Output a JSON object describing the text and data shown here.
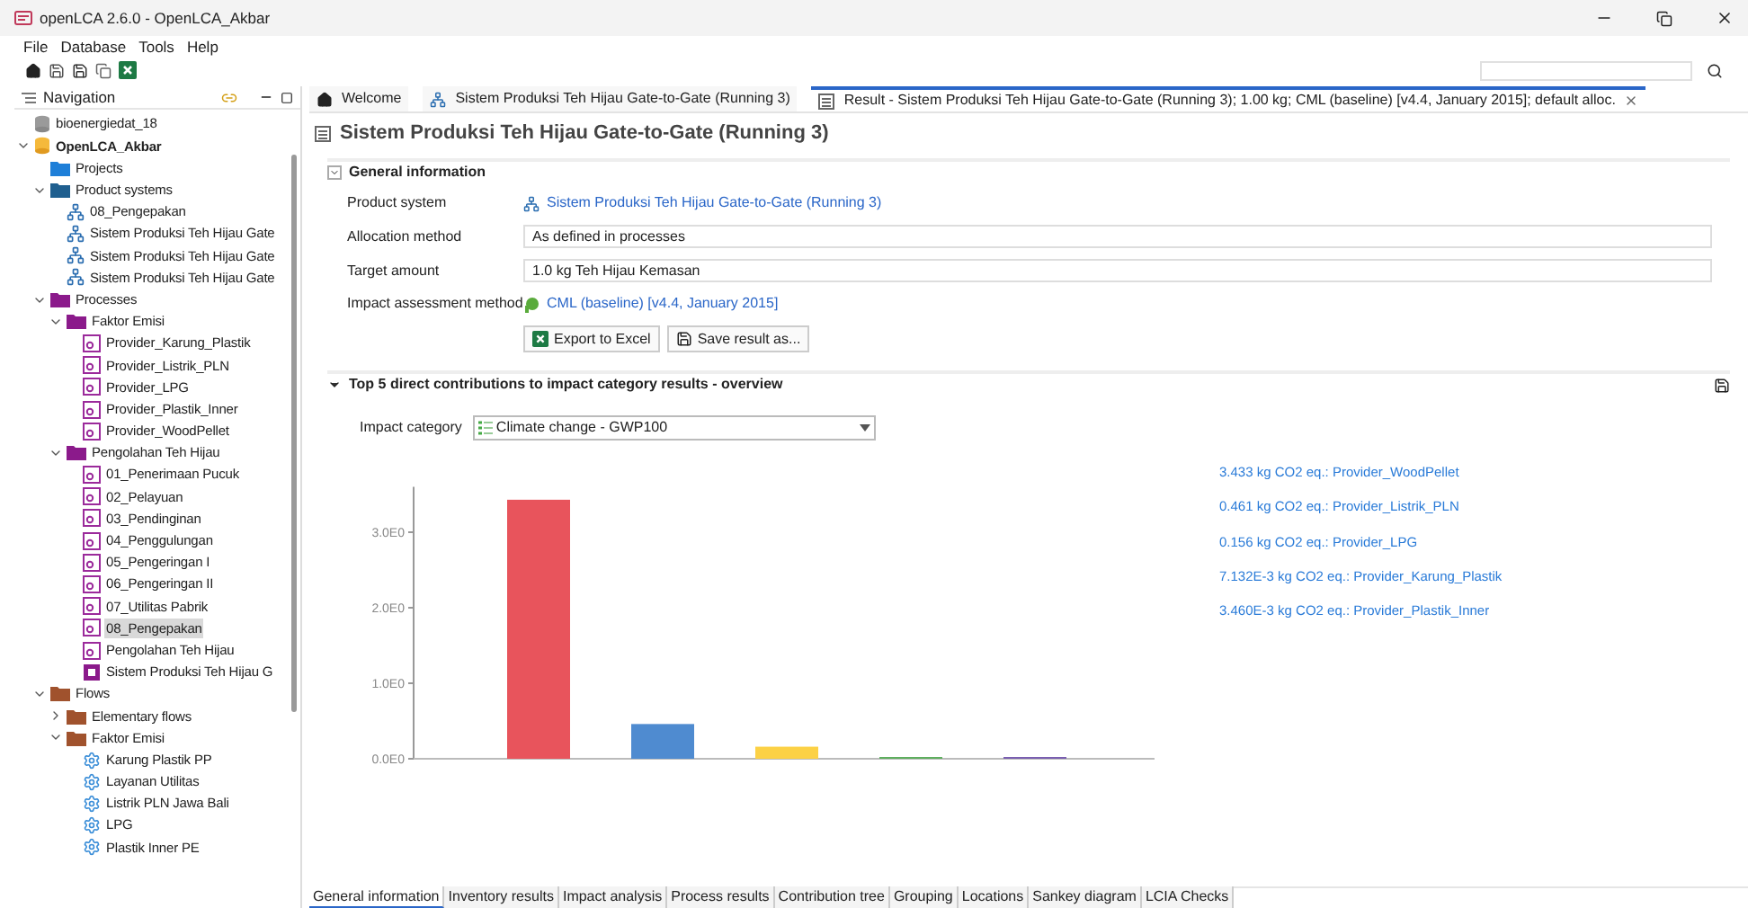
{
  "window": {
    "title": "openLCA 2.6.0 - OpenLCA_Akbar"
  },
  "menu": [
    "File",
    "Database",
    "Tools",
    "Help"
  ],
  "navigation": {
    "title": "Navigation",
    "tree": [
      {
        "label": "bioenergiedat_18",
        "kind": "database",
        "active": false,
        "selected": false
      },
      {
        "label": "OpenLCA_Akbar",
        "kind": "database",
        "active": true,
        "selected": false,
        "expanded": true,
        "children": [
          {
            "label": "Projects",
            "kind": "folder",
            "color": "#1e7fd8",
            "selected": false
          },
          {
            "label": "Product systems",
            "kind": "folder",
            "color": "#1f5f8f",
            "selected": false,
            "expanded": true,
            "children": [
              {
                "label": "08_Pengepakan",
                "kind": "system",
                "selected": false
              },
              {
                "label": "Sistem Produksi Teh Hijau Gate",
                "kind": "system",
                "selected": false
              },
              {
                "label": "Sistem Produksi Teh Hijau Gate",
                "kind": "system",
                "selected": false
              },
              {
                "label": "Sistem Produksi Teh Hijau Gate",
                "kind": "system",
                "selected": false
              }
            ]
          },
          {
            "label": "Processes",
            "kind": "folder",
            "color": "#8b1a8b",
            "selected": false,
            "expanded": true,
            "children": [
              {
                "label": "Faktor Emisi",
                "kind": "folder",
                "color": "#8b1a8b",
                "selected": false,
                "expanded": true,
                "children": [
                  {
                    "label": "Provider_Karung_Plastik",
                    "kind": "process",
                    "selected": false
                  },
                  {
                    "label": "Provider_Listrik_PLN",
                    "kind": "process",
                    "selected": false
                  },
                  {
                    "label": "Provider_LPG",
                    "kind": "process",
                    "selected": false
                  },
                  {
                    "label": "Provider_Plastik_Inner",
                    "kind": "process",
                    "selected": false
                  },
                  {
                    "label": "Provider_WoodPellet",
                    "kind": "process",
                    "selected": false
                  }
                ]
              },
              {
                "label": "Pengolahan Teh Hijau",
                "kind": "folder",
                "color": "#8b1a8b",
                "selected": false,
                "expanded": true,
                "children": [
                  {
                    "label": "01_Penerimaan Pucuk",
                    "kind": "process",
                    "selected": false
                  },
                  {
                    "label": "02_Pelayuan",
                    "kind": "process",
                    "selected": false
                  },
                  {
                    "label": "03_Pendinginan",
                    "kind": "process",
                    "selected": false
                  },
                  {
                    "label": "04_Penggulungan",
                    "kind": "process",
                    "selected": false
                  },
                  {
                    "label": "05_Pengeringan I",
                    "kind": "process",
                    "selected": false
                  },
                  {
                    "label": "06_Pengeringan II",
                    "kind": "process",
                    "selected": false
                  },
                  {
                    "label": "07_Utilitas Pabrik",
                    "kind": "process",
                    "selected": false
                  },
                  {
                    "label": "08_Pengepakan",
                    "kind": "process",
                    "selected": true
                  },
                  {
                    "label": "Pengolahan Teh Hijau",
                    "kind": "process",
                    "selected": false
                  },
                  {
                    "label": "Sistem Produksi Teh Hijau G",
                    "kind": "system-process",
                    "selected": false
                  }
                ]
              }
            ]
          },
          {
            "label": "Flows",
            "kind": "folder",
            "color": "#a0522d",
            "selected": false,
            "expanded": true,
            "children": [
              {
                "label": "Elementary flows",
                "kind": "folder",
                "color": "#a0522d",
                "selected": false,
                "expanded": false
              },
              {
                "label": "Faktor Emisi",
                "kind": "folder",
                "color": "#a0522d",
                "selected": false,
                "expanded": true,
                "children": [
                  {
                    "label": "Karung Plastik PP",
                    "kind": "flow",
                    "selected": false
                  },
                  {
                    "label": "Layanan Utilitas",
                    "kind": "flow",
                    "selected": false
                  },
                  {
                    "label": "Listrik PLN Jawa Bali",
                    "kind": "flow",
                    "selected": false
                  },
                  {
                    "label": "LPG",
                    "kind": "flow",
                    "selected": false
                  },
                  {
                    "label": "Plastik Inner PE",
                    "kind": "flow",
                    "selected": false
                  }
                ]
              }
            ]
          }
        ]
      }
    ]
  },
  "editor_tabs": [
    {
      "label": "Welcome",
      "kind": "home",
      "selected": false
    },
    {
      "label": "Sistem Produksi Teh Hijau Gate-to-Gate (Running 3)",
      "kind": "system",
      "selected": false
    },
    {
      "label": "Result - Sistem Produksi Teh Hijau Gate-to-Gate (Running 3); 1.00 kg; CML (baseline) [v4.4, January 2015]; default alloc.",
      "kind": "result",
      "selected": true
    }
  ],
  "page_title": "Sistem Produksi Teh Hijau Gate-to-Gate (Running 3)",
  "general_information": {
    "title": "General information",
    "expanded": true,
    "product_system": {
      "label": "Product system",
      "value": "Sistem Produksi Teh Hijau Gate-to-Gate (Running 3)"
    },
    "allocation_method": {
      "label": "Allocation method",
      "value": "As defined in processes"
    },
    "target_amount": {
      "label": "Target amount",
      "value": "1.0 kg Teh Hijau Kemasan"
    },
    "impact_method": {
      "label": "Impact assessment method",
      "value": "CML (baseline) [v4.4, January 2015]"
    },
    "buttons": [
      "Export to Excel",
      "Save result as..."
    ]
  },
  "contributions": {
    "title": "Top 5 direct contributions to impact category results - overview",
    "expanded": true,
    "impact_category": {
      "label": "Impact category",
      "value": "Climate change - GWP100"
    },
    "chart_data": {
      "type": "bar",
      "ylim": [
        0,
        3.6
      ],
      "yticks": [
        {
          "value": 0,
          "label": "0.0E0"
        },
        {
          "value": 1,
          "label": "1.0E0"
        },
        {
          "value": 2,
          "label": "2.0E0"
        },
        {
          "value": 3,
          "label": "3.0E0"
        }
      ],
      "series": [
        {
          "color": "#e8545c",
          "values": [
            3.43
          ]
        },
        {
          "color": "#4f8bd0",
          "values": [
            0.46
          ]
        },
        {
          "color": "#fcd145",
          "values": [
            0.16
          ]
        },
        {
          "color": "#5fae5f",
          "values": [
            0.01
          ]
        },
        {
          "color": "#7a5fb0",
          "values": [
            0.0
          ]
        }
      ]
    },
    "legend": [
      "3.433 kg CO2 eq.: Provider_WoodPellet",
      "0.461 kg CO2 eq.: Provider_Listrik_PLN",
      "0.156 kg CO2 eq.: Provider_LPG",
      "7.132E-3 kg CO2 eq.: Provider_Karung_Plastik",
      "3.460E-3 kg CO2 eq.: Provider_Plastik_Inner"
    ]
  },
  "bottom_tabs": [
    {
      "label": "General information",
      "selected": true
    },
    {
      "label": "Inventory results",
      "selected": false
    },
    {
      "label": "Impact analysis",
      "selected": false
    },
    {
      "label": "Process results",
      "selected": false
    },
    {
      "label": "Contribution tree",
      "selected": false
    },
    {
      "label": "Grouping",
      "selected": false
    },
    {
      "label": "Locations",
      "selected": false
    },
    {
      "label": "Sankey diagram",
      "selected": false
    },
    {
      "label": "LCIA Checks",
      "selected": false
    }
  ]
}
